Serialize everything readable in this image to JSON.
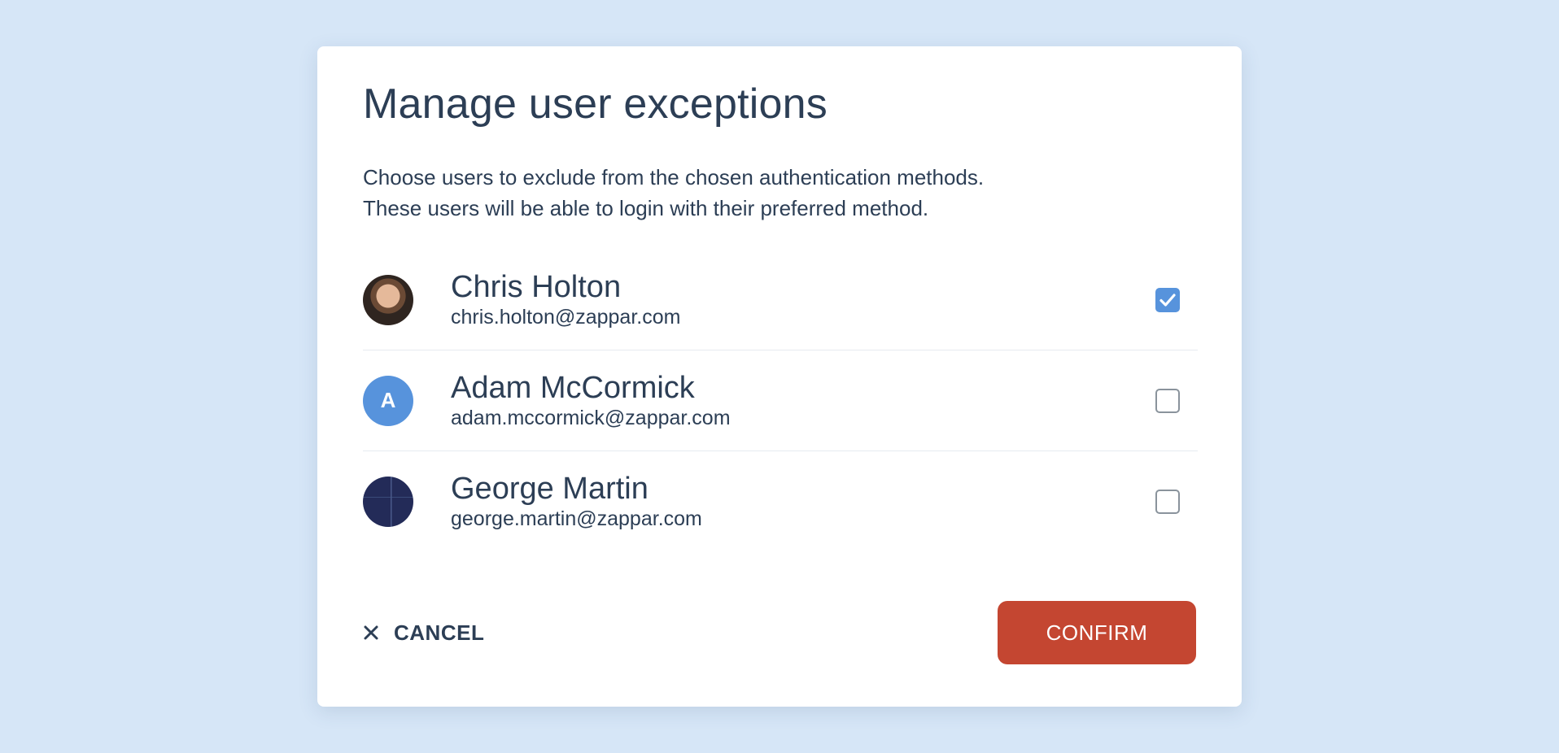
{
  "dialog": {
    "title": "Manage user exceptions",
    "description_line1": "Choose users to exclude from the chosen authentication methods.",
    "description_line2": "These users will be able to login with their preferred method."
  },
  "users": [
    {
      "name": "Chris Holton",
      "email": "chris.holton@zappar.com",
      "avatar": "photo",
      "checked": true
    },
    {
      "name": "Adam McCormick",
      "email": "adam.mccormick@zappar.com",
      "avatar": "initial",
      "initial": "A",
      "avatar_color": "#5793dc",
      "checked": false
    },
    {
      "name": "George Martin",
      "email": "george.martin@zappar.com",
      "avatar": "photo",
      "checked": false
    }
  ],
  "footer": {
    "cancel_label": "CANCEL",
    "confirm_label": "CONFIRM",
    "confirm_color": "#c44631"
  },
  "colors": {
    "background": "#d6e6f7",
    "text": "#2c3e55",
    "checkbox_checked": "#5793dc"
  },
  "icons": {
    "cancel": "close-icon",
    "checkmark": "checkmark-icon"
  }
}
